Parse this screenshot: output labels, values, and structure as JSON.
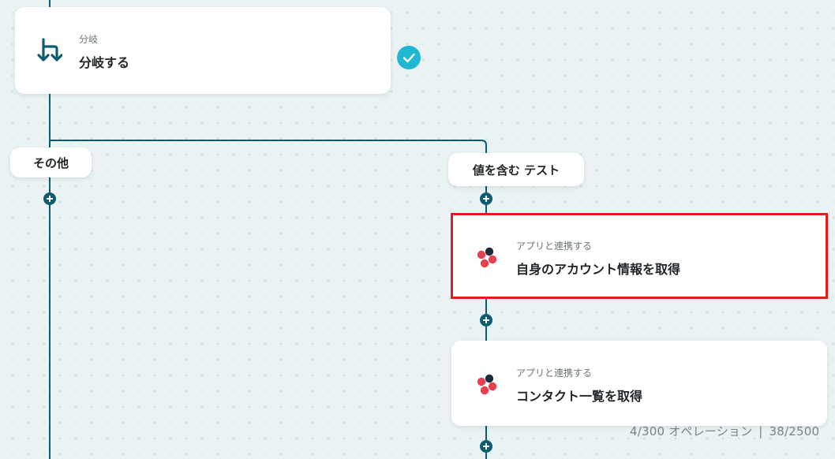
{
  "branch_node": {
    "subtitle": "分岐",
    "title": "分岐する",
    "icon": "branch-icon",
    "status": "completed"
  },
  "branches": {
    "other_label": "その他",
    "contains_label": "値を含む テスト"
  },
  "steps": [
    {
      "subtitle": "アプリと連携する",
      "title": "自身のアカウント情報を取得",
      "icon": "app-logo-icon",
      "selected": true
    },
    {
      "subtitle": "アプリと連携する",
      "title": "コンタクト一覧を取得",
      "icon": "app-logo-icon",
      "selected": false
    }
  ],
  "footer": {
    "operations": "4/300 オペレーション",
    "separator": "|",
    "tasks": "38/2500"
  },
  "colors": {
    "connector": "#0d5c72",
    "check": "#1fb8d3",
    "highlight": "#e21d1d",
    "logo_red": "#e8404f",
    "logo_dark": "#1d2b3a"
  }
}
